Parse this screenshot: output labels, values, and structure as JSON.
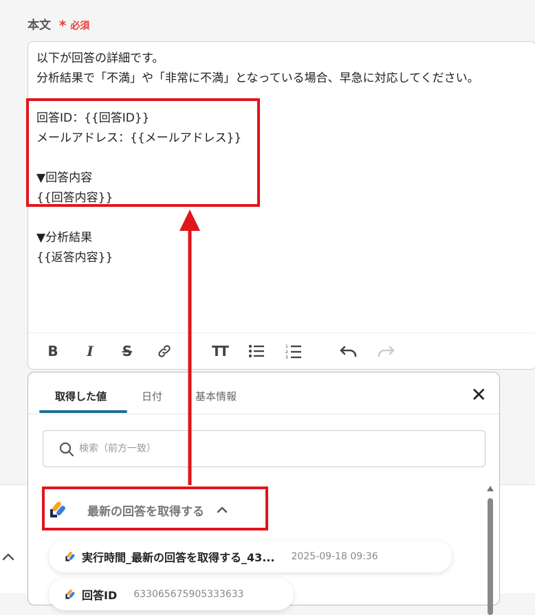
{
  "field": {
    "label": "本文",
    "required_star": "*",
    "required_text": "必須"
  },
  "editor": {
    "lines": [
      "以下が回答の詳細です。",
      "分析結果で「不満」や「非常に不満」となっている場合、早急に対応してください。",
      "",
      "回答ID：{{回答ID}}",
      "メールアドレス：{{メールアドレス}}",
      "",
      "▼回答内容",
      "{{回答内容}}",
      "",
      "▼分析結果",
      "{{返答内容}}"
    ]
  },
  "toolbar": {
    "bold_icon": "B",
    "italic_icon": "I",
    "strike_icon": "S",
    "link_icon": "link-icon",
    "text_size_icon": "TT",
    "bullet_list_icon": "bullet-list-icon",
    "numbered_list_icon": "numbered-list-icon",
    "undo_icon": "undo-icon",
    "redo_icon": "redo-icon"
  },
  "panel": {
    "tabs": [
      {
        "label": "取得した値",
        "active": true
      },
      {
        "label": "日付",
        "active": false
      },
      {
        "label": "基本情報",
        "active": false
      }
    ],
    "close_icon": "✕",
    "search_placeholder": "検索（前方一致）",
    "group": {
      "label": "最新の回答を取得する",
      "chevron": "chevron-up-icon"
    },
    "items": [
      {
        "label": "実行時間_最新の回答を取得する_43...",
        "value": "2025-09-18 09:36"
      },
      {
        "label": "回答ID",
        "value": "633065675905333633"
      }
    ]
  },
  "colors": {
    "highlight": "#e2141c",
    "tab_accent": "#1c6f8e",
    "required": "#e8413a"
  }
}
